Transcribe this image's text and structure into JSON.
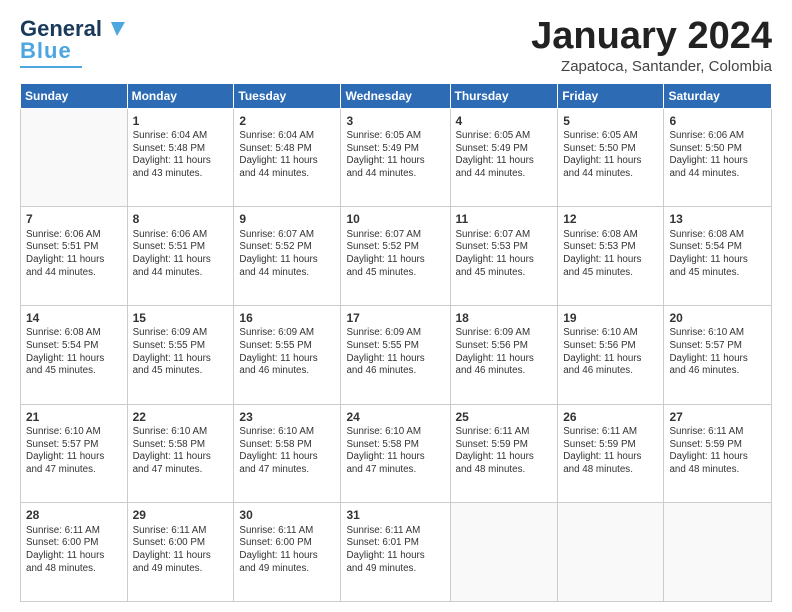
{
  "header": {
    "logo_general": "General",
    "logo_blue": "Blue",
    "month_title": "January 2024",
    "location": "Zapatoca, Santander, Colombia"
  },
  "weekdays": [
    "Sunday",
    "Monday",
    "Tuesday",
    "Wednesday",
    "Thursday",
    "Friday",
    "Saturday"
  ],
  "weeks": [
    [
      {
        "day": "",
        "info": ""
      },
      {
        "day": "1",
        "info": "Sunrise: 6:04 AM\nSunset: 5:48 PM\nDaylight: 11 hours\nand 43 minutes."
      },
      {
        "day": "2",
        "info": "Sunrise: 6:04 AM\nSunset: 5:48 PM\nDaylight: 11 hours\nand 44 minutes."
      },
      {
        "day": "3",
        "info": "Sunrise: 6:05 AM\nSunset: 5:49 PM\nDaylight: 11 hours\nand 44 minutes."
      },
      {
        "day": "4",
        "info": "Sunrise: 6:05 AM\nSunset: 5:49 PM\nDaylight: 11 hours\nand 44 minutes."
      },
      {
        "day": "5",
        "info": "Sunrise: 6:05 AM\nSunset: 5:50 PM\nDaylight: 11 hours\nand 44 minutes."
      },
      {
        "day": "6",
        "info": "Sunrise: 6:06 AM\nSunset: 5:50 PM\nDaylight: 11 hours\nand 44 minutes."
      }
    ],
    [
      {
        "day": "7",
        "info": "Sunrise: 6:06 AM\nSunset: 5:51 PM\nDaylight: 11 hours\nand 44 minutes."
      },
      {
        "day": "8",
        "info": "Sunrise: 6:06 AM\nSunset: 5:51 PM\nDaylight: 11 hours\nand 44 minutes."
      },
      {
        "day": "9",
        "info": "Sunrise: 6:07 AM\nSunset: 5:52 PM\nDaylight: 11 hours\nand 44 minutes."
      },
      {
        "day": "10",
        "info": "Sunrise: 6:07 AM\nSunset: 5:52 PM\nDaylight: 11 hours\nand 45 minutes."
      },
      {
        "day": "11",
        "info": "Sunrise: 6:07 AM\nSunset: 5:53 PM\nDaylight: 11 hours\nand 45 minutes."
      },
      {
        "day": "12",
        "info": "Sunrise: 6:08 AM\nSunset: 5:53 PM\nDaylight: 11 hours\nand 45 minutes."
      },
      {
        "day": "13",
        "info": "Sunrise: 6:08 AM\nSunset: 5:54 PM\nDaylight: 11 hours\nand 45 minutes."
      }
    ],
    [
      {
        "day": "14",
        "info": "Sunrise: 6:08 AM\nSunset: 5:54 PM\nDaylight: 11 hours\nand 45 minutes."
      },
      {
        "day": "15",
        "info": "Sunrise: 6:09 AM\nSunset: 5:55 PM\nDaylight: 11 hours\nand 45 minutes."
      },
      {
        "day": "16",
        "info": "Sunrise: 6:09 AM\nSunset: 5:55 PM\nDaylight: 11 hours\nand 46 minutes."
      },
      {
        "day": "17",
        "info": "Sunrise: 6:09 AM\nSunset: 5:55 PM\nDaylight: 11 hours\nand 46 minutes."
      },
      {
        "day": "18",
        "info": "Sunrise: 6:09 AM\nSunset: 5:56 PM\nDaylight: 11 hours\nand 46 minutes."
      },
      {
        "day": "19",
        "info": "Sunrise: 6:10 AM\nSunset: 5:56 PM\nDaylight: 11 hours\nand 46 minutes."
      },
      {
        "day": "20",
        "info": "Sunrise: 6:10 AM\nSunset: 5:57 PM\nDaylight: 11 hours\nand 46 minutes."
      }
    ],
    [
      {
        "day": "21",
        "info": "Sunrise: 6:10 AM\nSunset: 5:57 PM\nDaylight: 11 hours\nand 47 minutes."
      },
      {
        "day": "22",
        "info": "Sunrise: 6:10 AM\nSunset: 5:58 PM\nDaylight: 11 hours\nand 47 minutes."
      },
      {
        "day": "23",
        "info": "Sunrise: 6:10 AM\nSunset: 5:58 PM\nDaylight: 11 hours\nand 47 minutes."
      },
      {
        "day": "24",
        "info": "Sunrise: 6:10 AM\nSunset: 5:58 PM\nDaylight: 11 hours\nand 47 minutes."
      },
      {
        "day": "25",
        "info": "Sunrise: 6:11 AM\nSunset: 5:59 PM\nDaylight: 11 hours\nand 48 minutes."
      },
      {
        "day": "26",
        "info": "Sunrise: 6:11 AM\nSunset: 5:59 PM\nDaylight: 11 hours\nand 48 minutes."
      },
      {
        "day": "27",
        "info": "Sunrise: 6:11 AM\nSunset: 5:59 PM\nDaylight: 11 hours\nand 48 minutes."
      }
    ],
    [
      {
        "day": "28",
        "info": "Sunrise: 6:11 AM\nSunset: 6:00 PM\nDaylight: 11 hours\nand 48 minutes."
      },
      {
        "day": "29",
        "info": "Sunrise: 6:11 AM\nSunset: 6:00 PM\nDaylight: 11 hours\nand 49 minutes."
      },
      {
        "day": "30",
        "info": "Sunrise: 6:11 AM\nSunset: 6:00 PM\nDaylight: 11 hours\nand 49 minutes."
      },
      {
        "day": "31",
        "info": "Sunrise: 6:11 AM\nSunset: 6:01 PM\nDaylight: 11 hours\nand 49 minutes."
      },
      {
        "day": "",
        "info": ""
      },
      {
        "day": "",
        "info": ""
      },
      {
        "day": "",
        "info": ""
      }
    ]
  ]
}
